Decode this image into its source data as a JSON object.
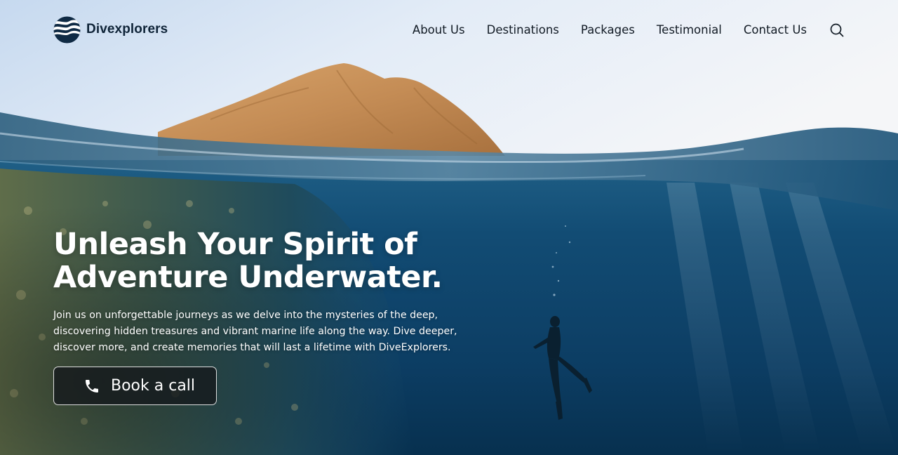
{
  "brand": {
    "name": "Divexplorers"
  },
  "nav": {
    "items": [
      {
        "label": "About Us"
      },
      {
        "label": "Destinations"
      },
      {
        "label": "Packages"
      },
      {
        "label": "Testimonial"
      },
      {
        "label": "Contact Us"
      }
    ],
    "search_icon": "search-icon"
  },
  "hero": {
    "headline_line1": "Unleash Your Spirit of",
    "headline_line2": "Adventure Underwater.",
    "subtext": "Join us on unforgettable journeys as we delve into the mysteries of the deep, discovering hidden treasures and vibrant marine life along the way. Dive deeper, discover more, and create memories that will last a lifetime with DiveExplorers.",
    "cta_label": "Book a call",
    "cta_icon": "phone-icon"
  },
  "colors": {
    "sky": "#dde9f6",
    "deep_water": "#0a3f63",
    "nav_text": "#111a24",
    "headline": "#ffffff",
    "cta_bg": "#14181c"
  }
}
